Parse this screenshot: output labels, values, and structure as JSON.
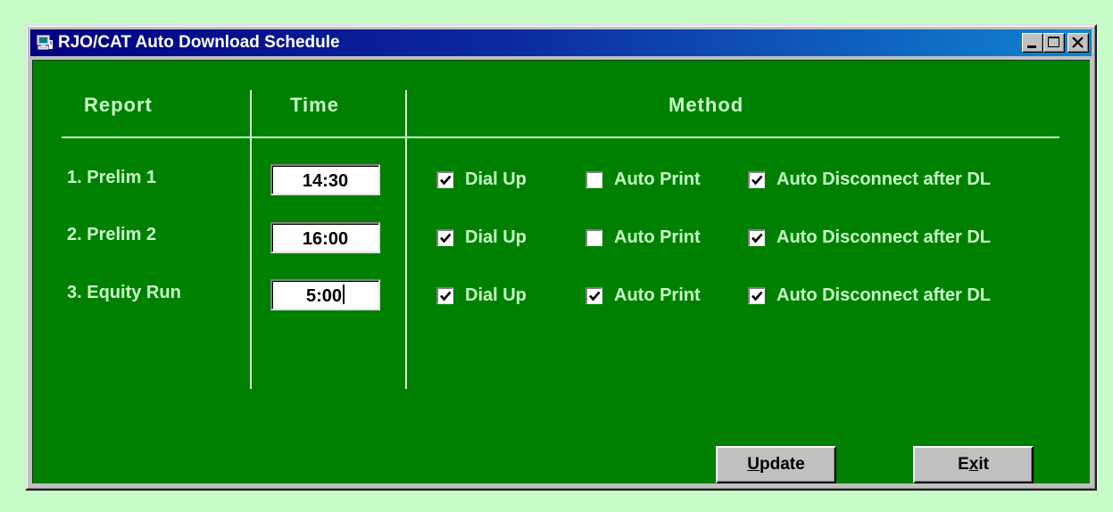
{
  "window": {
    "title": "RJO/CAT Auto Download Schedule",
    "icon": "app-icon",
    "controls": [
      "minimize-icon",
      "maximize-icon",
      "close-icon"
    ]
  },
  "headers": {
    "report": "Report",
    "time": "Time",
    "method": "Method"
  },
  "rows": [
    {
      "label": "1. Prelim 1",
      "time": "14:30",
      "dial_up": {
        "label": "Dial Up",
        "checked": true
      },
      "auto_print": {
        "label": "Auto Print",
        "checked": false
      },
      "auto_disconnect": {
        "label": "Auto Disconnect after DL",
        "checked": true
      }
    },
    {
      "label": "2. Prelim 2",
      "time": "16:00",
      "dial_up": {
        "label": "Dial Up",
        "checked": true
      },
      "auto_print": {
        "label": "Auto Print",
        "checked": false
      },
      "auto_disconnect": {
        "label": "Auto Disconnect after DL",
        "checked": true
      }
    },
    {
      "label": "3. Equity Run",
      "time": "5:00",
      "dial_up": {
        "label": "Dial Up",
        "checked": true
      },
      "auto_print": {
        "label": "Auto Print",
        "checked": true
      },
      "auto_disconnect": {
        "label": "Auto Disconnect after DL",
        "checked": true
      }
    }
  ],
  "buttons": {
    "update": {
      "accel": "U",
      "rest": "pdate"
    },
    "exit": {
      "pre": "E",
      "accel": "x",
      "rest": "it"
    }
  },
  "colors": {
    "page_background": "#c8fcc8",
    "client_background": "#008000",
    "label_text": "#c8fcc8",
    "titlebar_start": "#000080",
    "titlebar_end": "#1084d0"
  }
}
